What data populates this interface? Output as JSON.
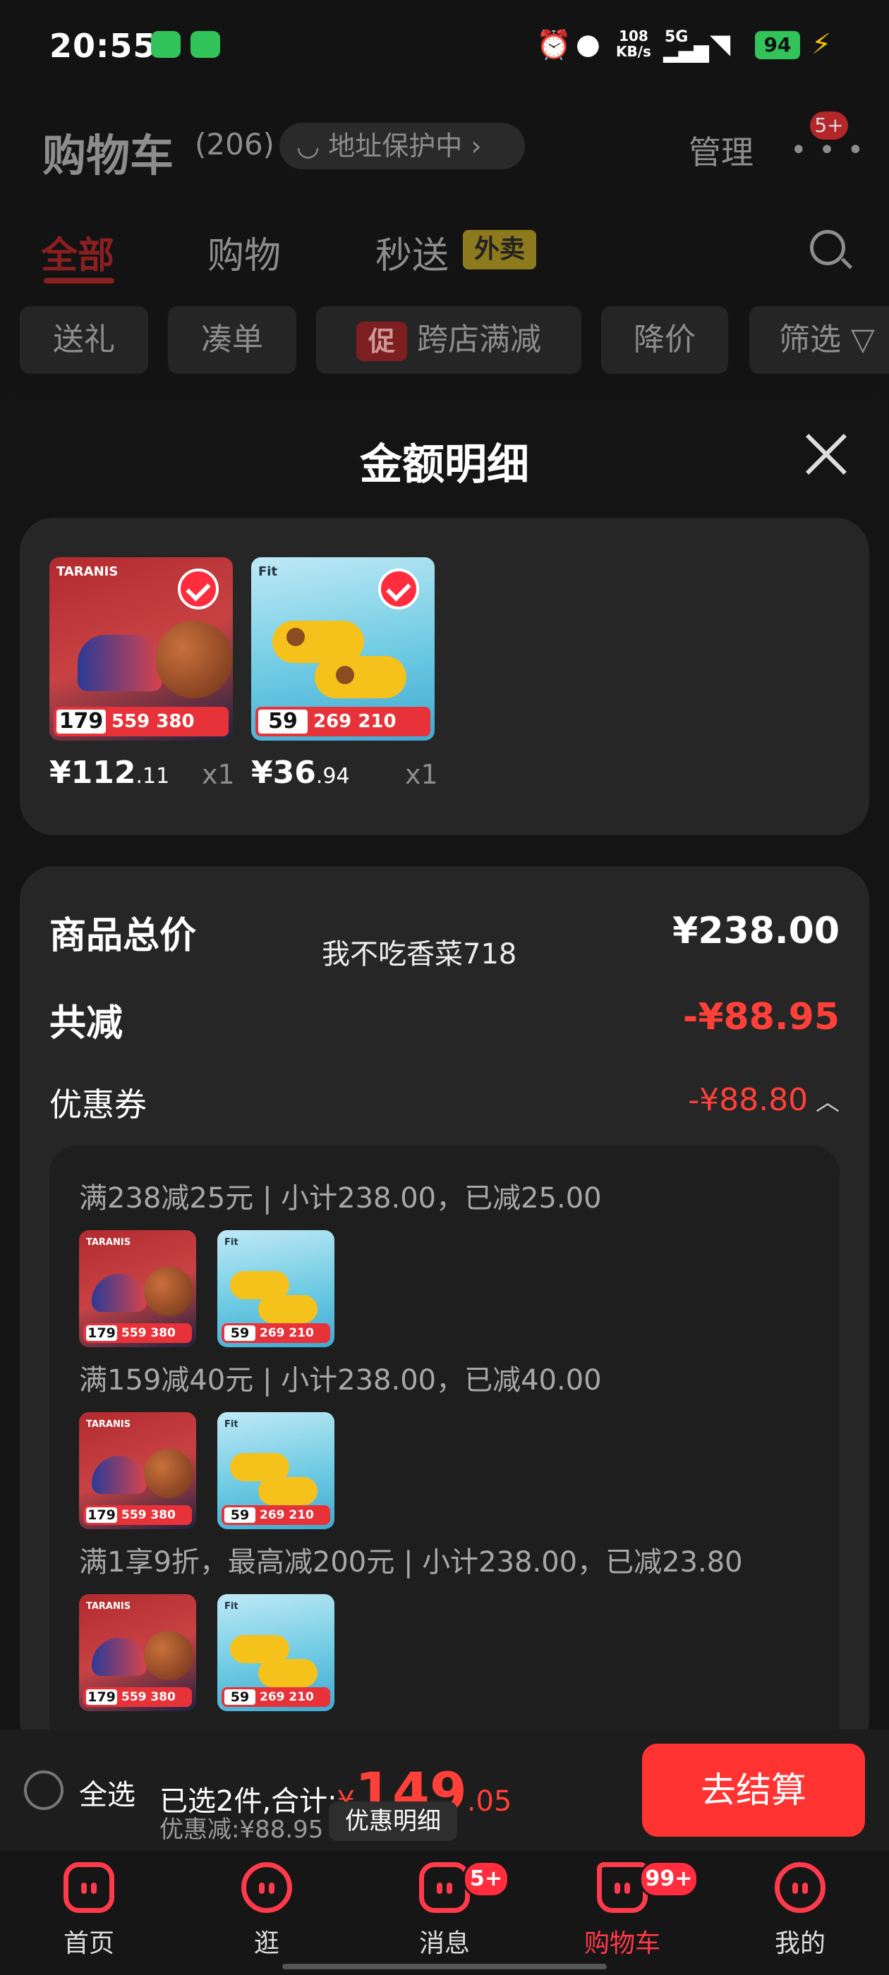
{
  "status_bar": {
    "time": "20:55",
    "net_speed_top": "108",
    "net_speed_unit": "KB/s",
    "network": "5G",
    "battery": "94"
  },
  "header": {
    "title": "购物车",
    "count": "(206)",
    "address_protection": "地址保护中",
    "manage": "管理",
    "more_badge": "5+"
  },
  "tabs": [
    {
      "label": "全部",
      "active": true
    },
    {
      "label": "购物"
    },
    {
      "label": "秒送"
    }
  ],
  "waimai_tag": "外卖",
  "filter_chips": [
    "送礼",
    "凑单",
    "跨店满减",
    "降价",
    "筛选"
  ],
  "promo_tag": "促",
  "sheet": {
    "title": "金额明细",
    "items": [
      {
        "brand": "TARANIS",
        "yen": "¥",
        "price_int": "112",
        "price_dec": ".11",
        "qty": "x1",
        "tag_price": "179"
      },
      {
        "brand": "Fit",
        "yen": "¥",
        "price_int": "36",
        "price_dec": ".94",
        "qty": "x1",
        "tag_price": "59"
      }
    ],
    "watermark": "我不吃香菜718",
    "rows": {
      "total_label": "商品总价",
      "total_value": "¥238.00",
      "saved_label": "共减",
      "saved_value": "-¥88.95",
      "coupon_label": "优惠券",
      "coupon_value": "-¥88.80"
    },
    "rules": [
      "满238减25元 | 小计238.00，已减25.00",
      "满159减40元 | 小计238.00，已减40.00",
      "满1享9折，最高减200元 | 小计238.00，已减23.80"
    ]
  },
  "bottom": {
    "select_all": "全选",
    "selected_text": "已选2件,合计:",
    "yen": "¥",
    "total_int": "149",
    "total_dec": ".05",
    "discount": "优惠减:¥88.95",
    "detail_button": "优惠明细",
    "checkout": "去结算"
  },
  "nav": [
    {
      "label": "首页",
      "icon": "home-icon"
    },
    {
      "label": "逛",
      "icon": "browse-icon"
    },
    {
      "label": "消息",
      "icon": "message-icon",
      "badge": "5+"
    },
    {
      "label": "购物车",
      "icon": "cart-icon",
      "badge": "99+",
      "active": true
    },
    {
      "label": "我的",
      "icon": "profile-icon"
    }
  ],
  "colors": {
    "accent": "#ff3332",
    "sheet_bg": "#141414",
    "card_bg": "#262626"
  }
}
